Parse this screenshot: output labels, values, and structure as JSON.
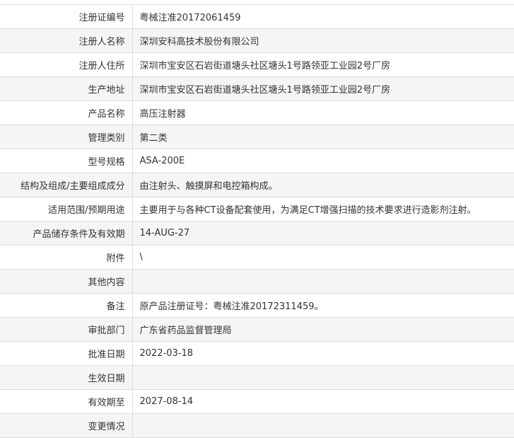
{
  "rows": [
    {
      "label": "注册证编号",
      "value": "粤械注准20172061459"
    },
    {
      "label": "注册人名称",
      "value": "深圳安科高技术股份有限公司"
    },
    {
      "label": "注册人住所",
      "value": "深圳市宝安区石岩街道塘头社区塘头1号路领亚工业园2号厂房"
    },
    {
      "label": "生产地址",
      "value": "深圳市宝安区石岩街道塘头社区塘头1号路领亚工业园2号厂房"
    },
    {
      "label": "产品名称",
      "value": "高压注射器"
    },
    {
      "label": "管理类别",
      "value": "第二类"
    },
    {
      "label": "型号规格",
      "value": "ASA-200E"
    },
    {
      "label": "结构及组成/主要组成成分",
      "value": "由注射头、触摸屏和电控箱构成。"
    },
    {
      "label": "适用范围/预期用途",
      "value": "主要用于与各种CT设备配套使用，为满足CT增强扫描的技术要求进行造影剂注射。"
    },
    {
      "label": "产品储存条件及有效期",
      "value": "14-AUG-27"
    },
    {
      "label": "附件",
      "value": "\\"
    },
    {
      "label": "其他内容",
      "value": ""
    },
    {
      "label": "备注",
      "value": "原产品注册证号：粤械注准20172311459。"
    },
    {
      "label": "审批部门",
      "value": "广东省药品监督管理局"
    },
    {
      "label": "批准日期",
      "value": "2022-03-18"
    },
    {
      "label": "生效日期",
      "value": ""
    },
    {
      "label": "有效期至",
      "value": "2027-08-14"
    },
    {
      "label": "变更情况",
      "value": ""
    }
  ]
}
